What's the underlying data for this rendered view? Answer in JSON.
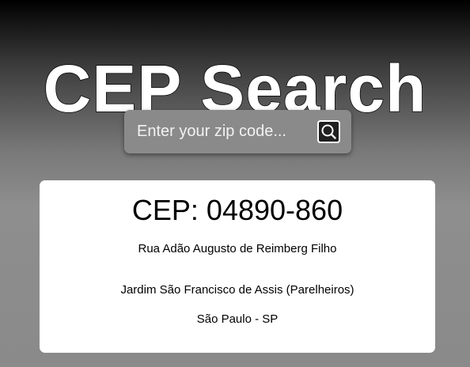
{
  "header": {
    "title": "CEP Search"
  },
  "search": {
    "placeholder": "Enter your zip code...",
    "value": "",
    "button_icon": "search-icon"
  },
  "result": {
    "cep_label": "CEP:",
    "cep_value": "04890-860",
    "cep_text": "CEP: 04890-860",
    "street": "Rua Adão Augusto de Reimberg Filho",
    "district": "Jardim São Francisco de Assis (Parelheiros)",
    "city_state": "São Paulo - SP"
  },
  "colors": {
    "title_text": "#ffffff",
    "card_background": "#ffffff",
    "search_background": "#8a8a8a",
    "search_button_background": "#1f1f1f"
  }
}
